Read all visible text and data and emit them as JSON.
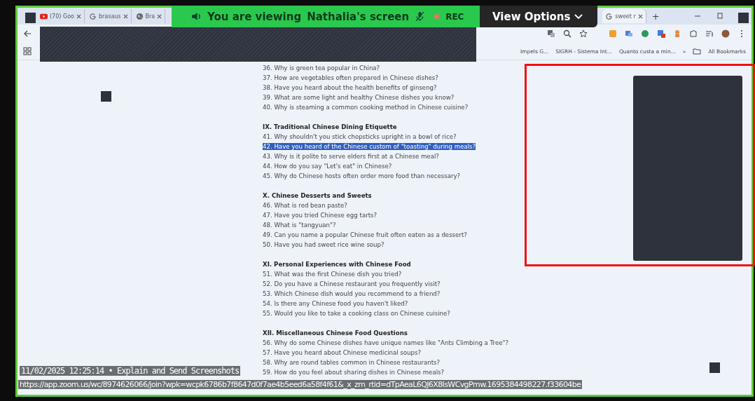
{
  "browser": {
    "tabs": [
      {
        "label": "(70) Goo",
        "kind": "video",
        "selected": false
      },
      {
        "label": "brasaus",
        "kind": "google",
        "selected": false
      },
      {
        "label": "Bra",
        "kind": "globe",
        "selected": false
      },
      {
        "label": "sweet r",
        "kind": "google",
        "selected": true
      }
    ],
    "new_tab": "+",
    "bookmarks": [
      {
        "label": "Impels G..."
      },
      {
        "label": "SIGRH - Sistema Int..."
      },
      {
        "label": "Quanto custa a min..."
      }
    ],
    "more_bookmarks": "»",
    "all_bookmarks": "All Bookmarks"
  },
  "share_banner": {
    "prefix": "You are viewing",
    "presenter": "Nathalia's screen",
    "recording": "REC",
    "view_options": "View Options"
  },
  "document": {
    "sections": [
      {
        "items": [
          {
            "text": "36. Why is green tea popular in China?",
            "selected": false
          },
          {
            "text": "37. How are vegetables often prepared in Chinese dishes?",
            "selected": false
          },
          {
            "text": "38. Have you heard about the health benefits of ginseng?",
            "selected": false
          },
          {
            "text": "39. What are some light and healthy Chinese dishes you know?",
            "selected": false
          },
          {
            "text": "40. Why is steaming a common cooking method in Chinese cuisine?",
            "selected": false
          }
        ]
      },
      {
        "heading": "IX. Traditional Chinese Dining Etiquette",
        "items": [
          {
            "text": "41. Why shouldn't you stick chopsticks upright in a bowl of rice?",
            "selected": false
          },
          {
            "text": "42. Have you heard of the Chinese custom of \"toasting\" during meals?",
            "selected": true
          },
          {
            "text": "43. Why is it polite to serve elders first at a Chinese meal?",
            "selected": false
          },
          {
            "text": "44. How do you say \"Let's eat\" in Chinese?",
            "selected": false
          },
          {
            "text": "45. Why do Chinese hosts often order more food than necessary?",
            "selected": false
          }
        ]
      },
      {
        "heading": "X. Chinese Desserts and Sweets",
        "items": [
          {
            "text": "46. What is red bean paste?",
            "selected": false
          },
          {
            "text": "47. Have you tried Chinese egg tarts?",
            "selected": false
          },
          {
            "text": "48. What is \"tangyuan\"?",
            "selected": false
          },
          {
            "text": "49. Can you name a popular Chinese fruit often eaten as a dessert?",
            "selected": false
          },
          {
            "text": "50. Have you had sweet rice wine soup?",
            "selected": false
          }
        ]
      },
      {
        "heading": "XI. Personal Experiences with Chinese Food",
        "items": [
          {
            "text": "51. What was the first Chinese dish you tried?",
            "selected": false
          },
          {
            "text": "52. Do you have a Chinese restaurant you frequently visit?",
            "selected": false
          },
          {
            "text": "53. Which Chinese dish would you recommend to a friend?",
            "selected": false
          },
          {
            "text": "54. Is there any Chinese food you haven't liked?",
            "selected": false
          },
          {
            "text": "55. Would you like to take a cooking class on Chinese cuisine?",
            "selected": false
          }
        ]
      },
      {
        "heading": "XII. Miscellaneous Chinese Food Questions",
        "items": [
          {
            "text": "56. Why do some Chinese dishes have unique names like \"Ants Climbing a Tree\"?",
            "selected": false
          },
          {
            "text": "57. Have you heard about Chinese medicinal soups?",
            "selected": false
          },
          {
            "text": "58. Why are round tables common in Chinese restaurants?",
            "selected": false
          },
          {
            "text": "59. How do you feel about sharing dishes in Chinese meals?",
            "selected": false
          }
        ]
      }
    ]
  },
  "capture_overlay": {
    "timestamp": "11/02/2025 12:25:14 • Explain and Send Screenshots",
    "url": "https://app.zoom.us/wc/8974626066/join?wpk=wcpk6786b7f8647d0f7ae4b5eed6a58f4f61&_x_zm_rtid=dTpAeaL6QJ6X8IsWCvgPmw.1695384498227.f33604be"
  }
}
